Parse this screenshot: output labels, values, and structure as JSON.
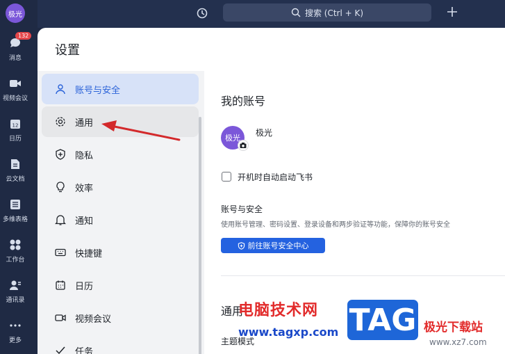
{
  "topbar": {
    "search_text": "搜索 (Ctrl + K)"
  },
  "rail": {
    "avatar": "极光",
    "items": [
      {
        "label": "消息",
        "badge": "132"
      },
      {
        "label": "视频会议"
      },
      {
        "label": "日历"
      },
      {
        "label": "云文档"
      },
      {
        "label": "多维表格"
      },
      {
        "label": "工作台"
      },
      {
        "label": "通讯录"
      },
      {
        "label": "更多"
      }
    ]
  },
  "panel": {
    "title": "设置",
    "nav": [
      {
        "label": "账号与安全"
      },
      {
        "label": "通用"
      },
      {
        "label": "隐私"
      },
      {
        "label": "效率"
      },
      {
        "label": "通知"
      },
      {
        "label": "快捷键"
      },
      {
        "label": "日历"
      },
      {
        "label": "视频会议"
      },
      {
        "label": "任务"
      }
    ],
    "content": {
      "heading": "我的账号",
      "avatar_text": "极光",
      "user_name": "极光",
      "autostart_label": "开机时自动启动飞书",
      "security_title": "账号与安全",
      "security_desc": "使用账号管理、密码设置、登录设备和两步验证等功能，保障你的账号安全",
      "security_button": "前往账号安全中心",
      "general_heading": "通用",
      "theme_label": "主题模式"
    }
  },
  "watermark": {
    "line1": "电脑技术网",
    "line2": "www.tagxp.com",
    "tag": "TAG",
    "line3": "极光下载站",
    "line4": "www.xz7.com"
  },
  "colors": {
    "accent": "#2462e0",
    "rail": "#1f2a44",
    "active_nav": "#d7e2f8"
  }
}
